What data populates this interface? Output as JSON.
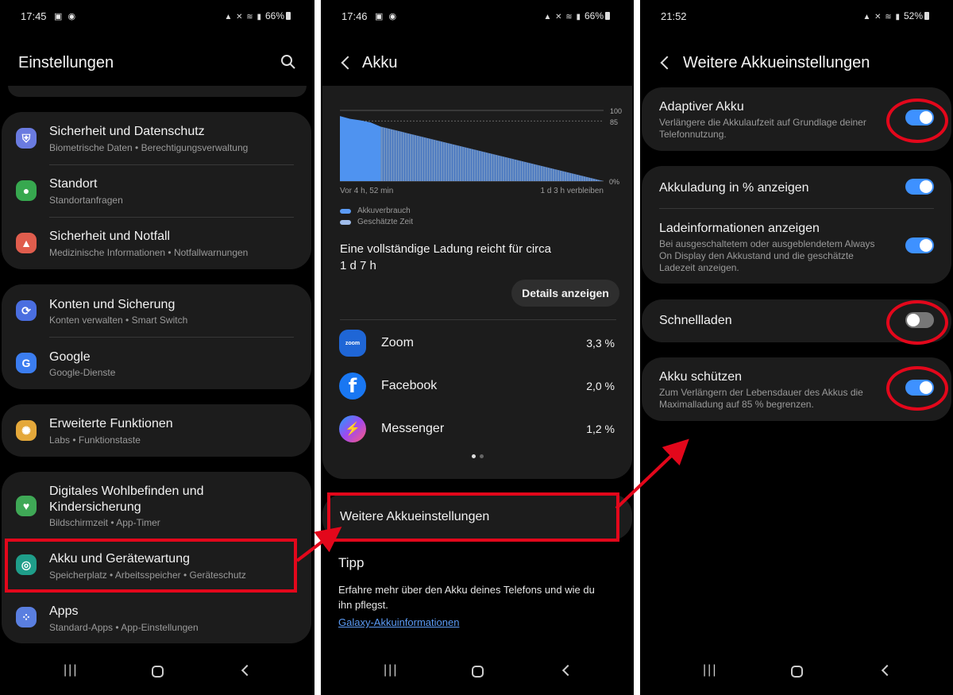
{
  "phone1": {
    "status": {
      "time": "17:45",
      "battery": "66%"
    },
    "title": "Einstellungen",
    "items": [
      {
        "title": "Sicherheit und Datenschutz",
        "subtitle": "Biometrische Daten  •  Berechtigungsverwaltung",
        "icon": "shield-icon",
        "color": "#6a7be0"
      },
      {
        "title": "Standort",
        "subtitle": "Standortanfragen",
        "icon": "location-pin-icon",
        "color": "#37a84f"
      },
      {
        "title": "Sicherheit und Notfall",
        "subtitle": "Medizinische Informationen  •  Notfallwarnungen",
        "icon": "emergency-icon",
        "color": "#e05d4d"
      },
      {
        "title": "Konten und Sicherung",
        "subtitle": "Konten verwalten  •  Smart Switch",
        "icon": "sync-icon",
        "color": "#4a6ee0"
      },
      {
        "title": "Google",
        "subtitle": "Google-Dienste",
        "icon": "google-icon",
        "color": "#3b7df0"
      },
      {
        "title": "Erweiterte Funktionen",
        "subtitle": "Labs  •  Funktionstaste",
        "icon": "gear-star-icon",
        "color": "#e4a83a"
      },
      {
        "title": "Digitales Wohlbefinden und",
        "title2": "Kindersicherung",
        "subtitle": "Bildschirmzeit  •  App-Timer",
        "icon": "heart-icon",
        "color": "#3fa856"
      },
      {
        "title": "Akku und Gerätewartung",
        "subtitle": "Speicherplatz  •  Arbeitsspeicher  •  Geräteschutz",
        "icon": "battery-care-icon",
        "color": "#1f9e8a"
      },
      {
        "title": "Apps",
        "subtitle": "Standard-Apps  •  App-Einstellungen",
        "icon": "apps-grid-icon",
        "color": "#5a7fe0"
      }
    ]
  },
  "phone2": {
    "status": {
      "time": "17:46",
      "battery": "66%"
    },
    "title": "Akku",
    "chart": {
      "y_top": "100",
      "y_mid": "85",
      "y_bottom": "0%",
      "x_left": "Vor 4 h, 52 min",
      "x_right": "1 d 3 h verbleiben",
      "legend_usage": "Akkuverbrauch",
      "legend_estimate": "Geschätzte Zeit"
    },
    "chart_data": {
      "type": "area",
      "ylim": [
        0,
        100
      ],
      "series": [
        {
          "name": "Akkuverbrauch",
          "values": [
            92,
            88,
            86,
            83,
            77
          ]
        },
        {
          "name": "Geschätzte Zeit",
          "values": [
            77,
            0
          ]
        }
      ]
    },
    "full_charge_text": "Eine vollständige Ladung reicht für circa",
    "full_charge_value": "1 d 7 h",
    "details_button": "Details anzeigen",
    "apps": [
      {
        "name": "Zoom",
        "percent": "3,3 %",
        "icon_label": "zoom",
        "color": "#1f66d6"
      },
      {
        "name": "Facebook",
        "percent": "2,0 %",
        "icon_label": "f",
        "color": "#1977f2"
      },
      {
        "name": "Messenger",
        "percent": "1,2 %",
        "icon_label": "⚡",
        "color": "#a048ef"
      }
    ],
    "more_settings": "Weitere Akkueinstellungen",
    "tip_title": "Tipp",
    "tip_text_1": "Erfahre mehr über den Akku deines Telefons und wie du",
    "tip_text_2": "ihn pflegst.",
    "tip_link": "Galaxy-Akkuinformationen"
  },
  "phone3": {
    "status": {
      "time": "21:52",
      "battery": "52%"
    },
    "title": "Weitere Akkueinstellungen",
    "settings": [
      {
        "title": "Adaptiver Akku",
        "desc1": "Verlängere die Akkulaufzeit auf Grundlage deiner",
        "desc2": "Telefonnutzung.",
        "on": true
      },
      {
        "title": "Akkuladung in % anzeigen",
        "on": true
      },
      {
        "title": "Ladeinformationen anzeigen",
        "desc1": "Bei ausgeschaltetem oder ausgeblendetem Always",
        "desc2": "On Display den Akkustand und die geschätzte",
        "desc3": "Ladezeit anzeigen.",
        "on": true
      },
      {
        "title": "Schnellladen",
        "on": false
      },
      {
        "title": "Akku schützen",
        "desc1": "Zum Verlängern der Lebensdauer des Akkus die",
        "desc2": "Maximalladung auf 85 % begrenzen.",
        "on": true
      }
    ]
  },
  "colors": {
    "accent": "#3e91ff",
    "highlight": "#e3071b",
    "card": "#1c1c1c",
    "link": "#5b9bf5"
  }
}
